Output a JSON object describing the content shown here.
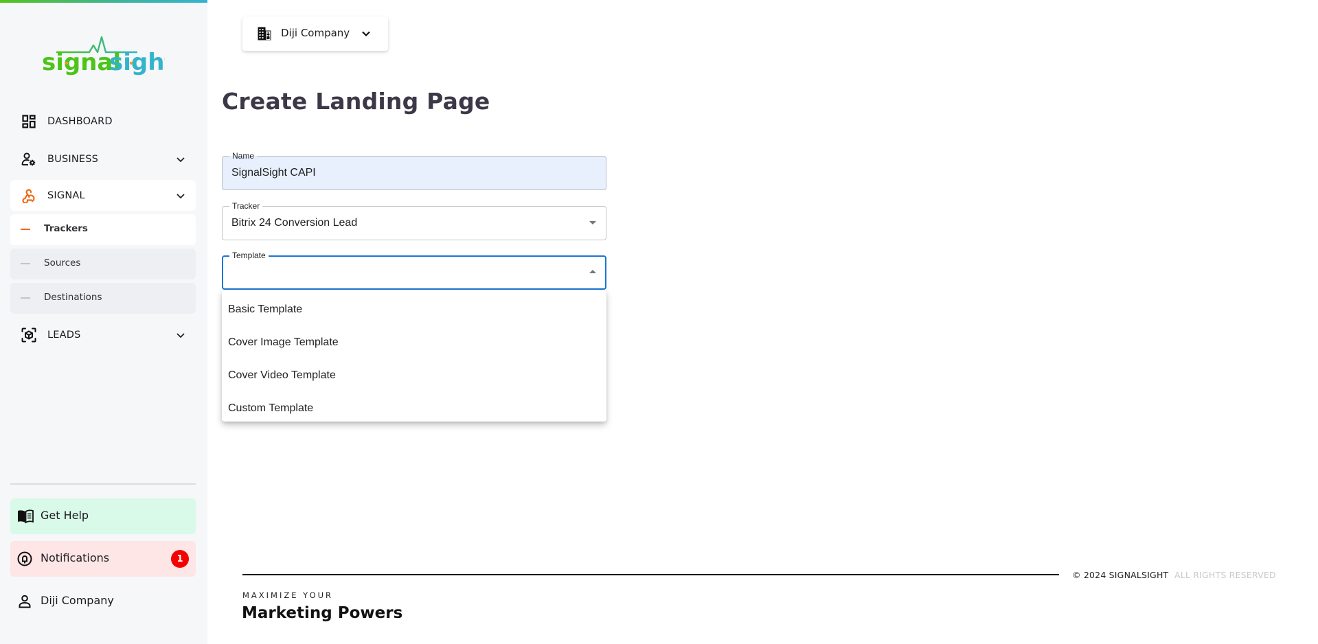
{
  "brand": {
    "logo_part1": "signal",
    "logo_part2": "sight",
    "colors": {
      "green": "#4cc418",
      "teal": "#34b3cc",
      "accent_orange": "#f06a14"
    }
  },
  "sidebar": {
    "nav": [
      {
        "label": "DASHBOARD",
        "icon": "dashboard-icon",
        "expandable": false,
        "active": false
      },
      {
        "label": "BUSINESS",
        "icon": "user-gear-icon",
        "expandable": true,
        "active": false
      },
      {
        "label": "SIGNAL",
        "icon": "webhook-icon",
        "expandable": true,
        "active": true
      },
      {
        "label": "LEADS",
        "icon": "cube-scan-icon",
        "expandable": true,
        "active": false
      }
    ],
    "signal_subitems": [
      {
        "label": "Trackers",
        "active": true
      },
      {
        "label": "Sources",
        "active": false
      },
      {
        "label": "Destinations",
        "active": false
      }
    ],
    "bottom": {
      "help": {
        "label": "Get Help",
        "icon": "book-icon"
      },
      "notifications": {
        "label": "Notifications",
        "icon": "bell-icon",
        "count": "1"
      },
      "profile": {
        "label": "Diji Company",
        "icon": "user-icon"
      }
    }
  },
  "header": {
    "company_selector": {
      "label": "Diji Company",
      "icon": "building-icon"
    }
  },
  "main": {
    "title": "Create Landing Page",
    "form": {
      "name": {
        "label": "Name",
        "value": "SignalSight CAPI"
      },
      "tracker": {
        "label": "Tracker",
        "value": "Bitrix 24 Conversion Lead"
      },
      "template": {
        "label": "Template",
        "value": "",
        "open": true,
        "options": [
          "Basic Template",
          "Cover Image Template",
          "Cover Video Template",
          "Custom Template"
        ]
      }
    }
  },
  "footer": {
    "tagline_small": "MAXIMIZE YOUR",
    "tagline_big": "Marketing Powers",
    "copyright": "© 2024 SIGNALSIGHT",
    "rights": "ALL RIGHTS RESERVED"
  }
}
